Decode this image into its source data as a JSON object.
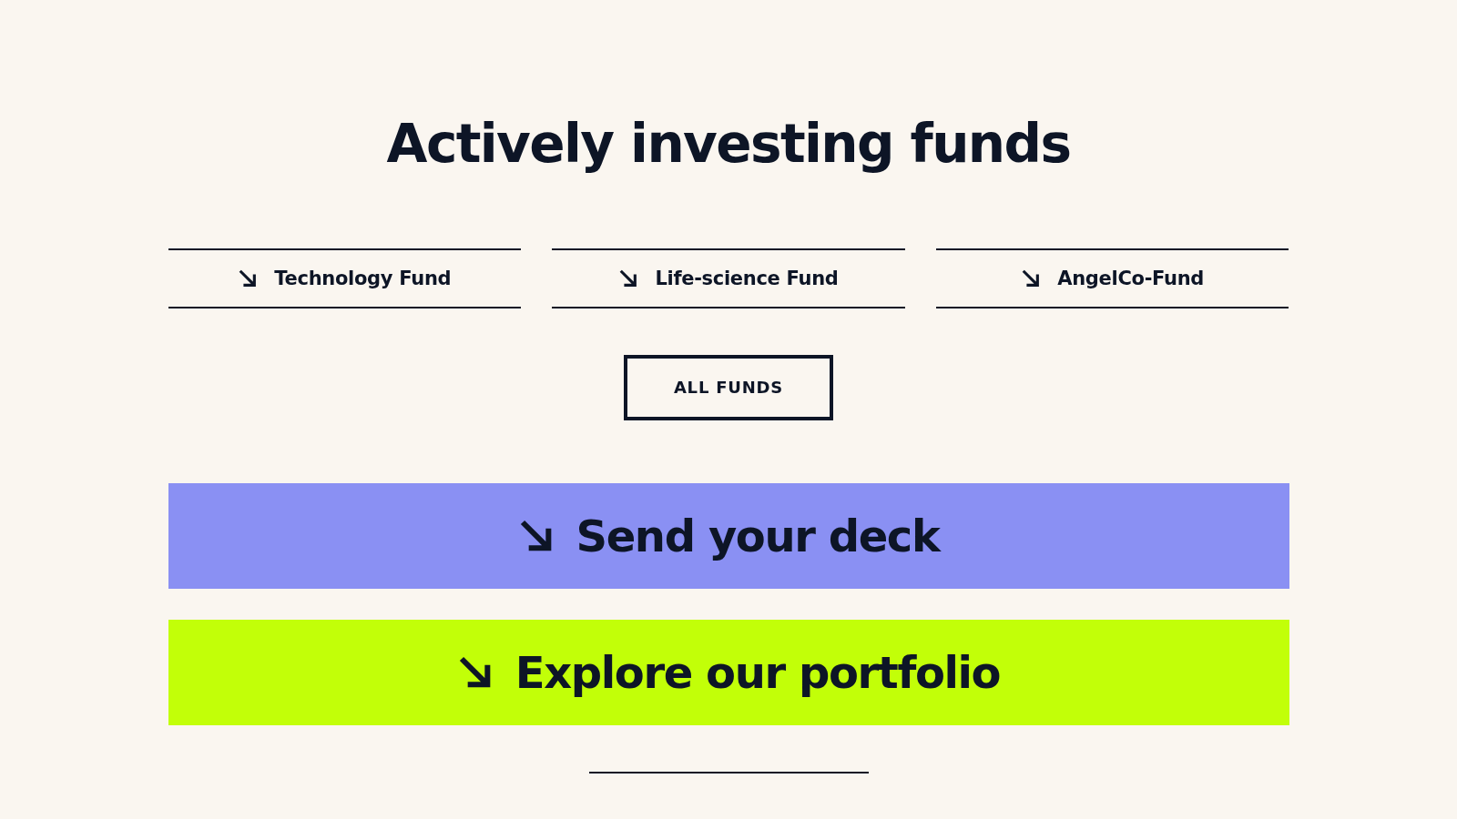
{
  "heading": "Actively investing funds",
  "funds": [
    {
      "label": "Technology Fund"
    },
    {
      "label": "Life-science Fund"
    },
    {
      "label": "AngelCo-Fund"
    }
  ],
  "all_funds_button": "ALL FUNDS",
  "cta_buttons": [
    {
      "label": "Send your deck",
      "color": "#8a90f3"
    },
    {
      "label": "Explore our portfolio",
      "color": "#c2ff08"
    }
  ]
}
